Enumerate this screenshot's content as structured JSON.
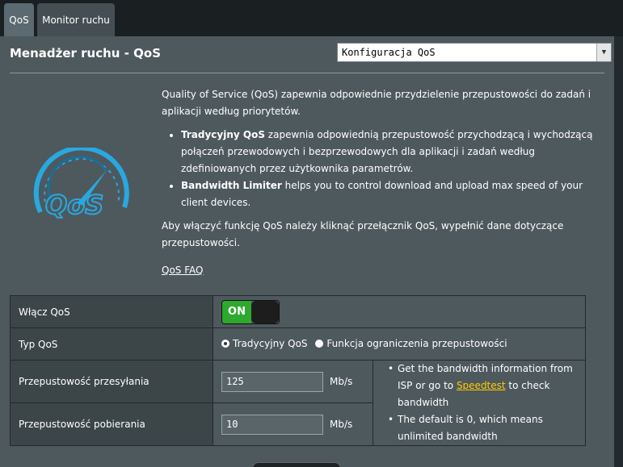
{
  "tabs": [
    {
      "label": "QoS",
      "active": true
    },
    {
      "label": "Monitor ruchu",
      "active": false
    }
  ],
  "header": {
    "title": "Menadżer ruchu - QoS",
    "select_value": "Konfiguracja QoS"
  },
  "logo": {
    "text": "QoS",
    "icon": "qos-speedometer-icon",
    "color": "#29a8e0"
  },
  "description": {
    "intro": "Quality of Service (QoS) zapewnia odpowiednie przydzielenie przepustowości do zadań i aplikacji według priorytetów.",
    "bullets": [
      {
        "bold": "Tradycyjny QoS",
        "text": " zapewnia odpowiednią przepustowość przychodzącą i wychodzącą połączeń przewodowych i bezprzewodowych dla aplikacji i zadań według zdefiniowanych przez użytkownika parametrów."
      },
      {
        "bold": "Bandwidth Limiter",
        "text": " helps you to control download and upload max speed of your client devices."
      }
    ],
    "instruction": "Aby włączyć funkcję QoS należy kliknąć przełącznik QoS, wypełnić dane dotyczące przepustowości.",
    "faq": "QoS FAQ"
  },
  "form": {
    "enable_label": "Włącz QoS",
    "toggle_on": "ON",
    "type_label": "Typ QoS",
    "type_options": [
      "Tradycyjny QoS",
      "Funkcja ograniczenia przepustowości"
    ],
    "type_selected": 0,
    "upload_label": "Przepustowość przesyłania",
    "upload_value": "125",
    "download_label": "Przepustowość pobierania",
    "download_value": "10",
    "unit": "Mb/s",
    "note1_before": "Get the bandwidth information from ISP or go to ",
    "note1_link": "Speedtest",
    "note1_after": " to check bandwidth",
    "note2": "The default is 0, which means unlimited bandwidth"
  },
  "colors": {
    "accent": "#29a8e0",
    "toggle_on": "#2ea82e",
    "link": "#ffcc00"
  }
}
